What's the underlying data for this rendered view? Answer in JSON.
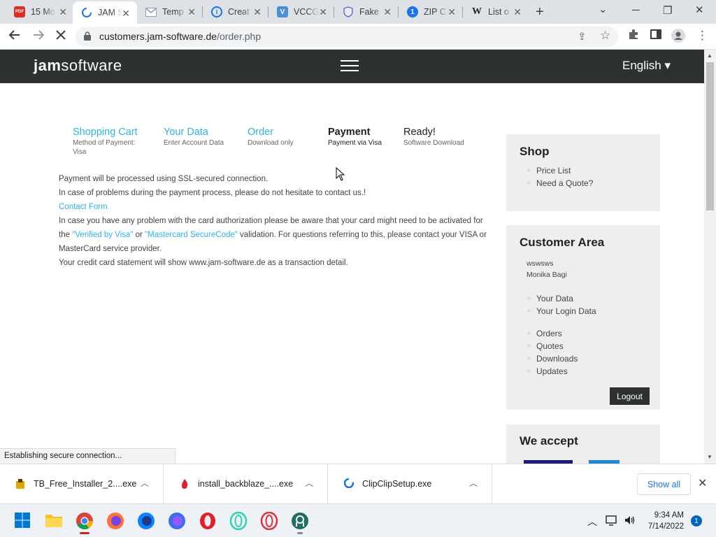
{
  "browser": {
    "tabs": [
      {
        "title": "15 Mo",
        "icon": "pdf-icon",
        "color": "#d93025"
      },
      {
        "title": "JAM S",
        "icon": "loading-spinner-icon",
        "color": "#1a73e8",
        "active": true
      },
      {
        "title": "Temp",
        "icon": "gmail-icon",
        "color": "#8e9eb4"
      },
      {
        "title": "Creat",
        "icon": "info-circle-icon",
        "color": "#1a73e8"
      },
      {
        "title": "VCCG",
        "icon": "v-logo-icon",
        "color": "#4a90d9"
      },
      {
        "title": "Fake",
        "icon": "shield-icon",
        "color": "#5b6fd8"
      },
      {
        "title": "ZIP C",
        "icon": "number-one-icon",
        "color": "#1a73e8"
      },
      {
        "title": "List o",
        "icon": "wikipedia-icon",
        "color": "#202124"
      }
    ],
    "url_host": "customers.jam-software.de",
    "url_path": "/order.php",
    "status_text": "Establishing secure connection..."
  },
  "site": {
    "logo_bold": "jam",
    "logo_light": "software",
    "language": "English ▾"
  },
  "steps": [
    {
      "title": "Shopping Cart",
      "desc": "Method of Payment: Visa",
      "state": "done"
    },
    {
      "title": "Your Data",
      "desc": "Enter Account Data",
      "state": "done"
    },
    {
      "title": "Order",
      "desc": "Download only",
      "state": "done"
    },
    {
      "title": "Payment",
      "desc": "Payment via Visa",
      "state": "current"
    },
    {
      "title": "Ready!",
      "desc": "Software Download",
      "state": "next"
    }
  ],
  "content": {
    "line1": "Payment will be processed using SSL-secured connection.",
    "line2": "In case of problems during the payment process, please do not hesitate to contact us.!",
    "contact_link": "Contact Form",
    "line3_pre": "In case you have any problem with the card authorization please be aware that your card might need to be activated for the ",
    "verified_visa": "\"Verified by Visa\"",
    "or": " or ",
    "mastercard": "\"Mastercard SecureCode\"",
    "line3_post": " validation. For questions referring to this, please contact your VISA or MasterCard service provider.",
    "line4": "Your credit card statement will show www.jam-software.de as a transaction detail."
  },
  "sidebar": {
    "shop": {
      "title": "Shop",
      "items": [
        "Price List",
        "Need a Quote?"
      ]
    },
    "customer": {
      "title": "Customer Area",
      "user_line1": "wswsws",
      "user_line2": "Monika Bagi",
      "items_a": [
        "Your Data",
        "Your Login Data"
      ],
      "items_b": [
        "Orders",
        "Quotes",
        "Downloads",
        "Updates"
      ],
      "logout": "Logout"
    },
    "accept": {
      "title": "We accept"
    }
  },
  "downloads": [
    {
      "name": "TB_Free_Installer_2....exe",
      "icon": "installer-icon"
    },
    {
      "name": "install_backblaze_....exe",
      "icon": "backblaze-flame-icon"
    },
    {
      "name": "ClipClipSetup.exe",
      "icon": "clipclip-icon"
    }
  ],
  "downloads_show_all": "Show all",
  "taskbar": {
    "time": "9:34 AM",
    "date": "7/14/2022",
    "notifications": "1"
  },
  "colors": {
    "accent": "#2eb2e8",
    "header_bg": "#2e3132",
    "sidebar_bg": "#eeeeee"
  }
}
